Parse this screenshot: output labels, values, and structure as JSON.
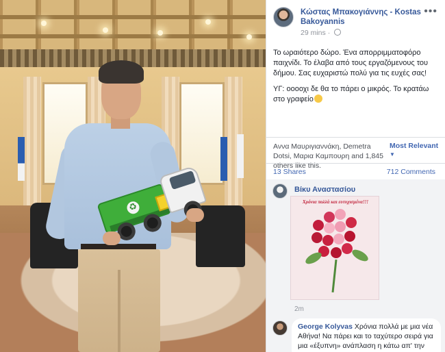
{
  "post": {
    "author": "Κώστας Μπακογιάννης - Kostas Bakoyannis",
    "time": "29 mins",
    "text_line1": "Το ωραιότερο δώρο. Ένα απορριμματοφόρο παιχνίδι. Το έλαβα από τους εργαζόμενους του δήμου. Σας ευχαριστώ πολύ για τις ευχές σας!",
    "text_line2": "ΥΓ: οοοοχι δε θα το πάρει ο μικρός. Το κρατάω στο γραφείο",
    "likes": "Αννα Μαυριγιαννάκη, Demetra Dotsi, Μαρια Καμπουρη and 1,845 others like this.",
    "sort_label": "Most Relevant",
    "shares": "13 Shares",
    "comments_count": "712 Comments"
  },
  "comments": [
    {
      "name": "Βίκυ Αναστασίου",
      "card_caption": "Χρόνια πολλά και ευτυχισμένα!!!",
      "time": "2m"
    },
    {
      "name": "George Kolyvas",
      "text": "Χρόνια πολλά με μια νέα Αθήνα! Να πάρει και το ταχύτερο σειρά για μια «έξυπνη» ανάπλαση η κάτω απ' την Ομόνοια περιοχή, πεδίο του Άρεως"
    }
  ],
  "icons": {
    "more": "more-options-icon",
    "privacy": "globe-icon",
    "sort": "chevron-down-icon"
  },
  "colors": {
    "link": "#365899",
    "fb_blue": "#4267b2",
    "muted": "#90949c"
  }
}
